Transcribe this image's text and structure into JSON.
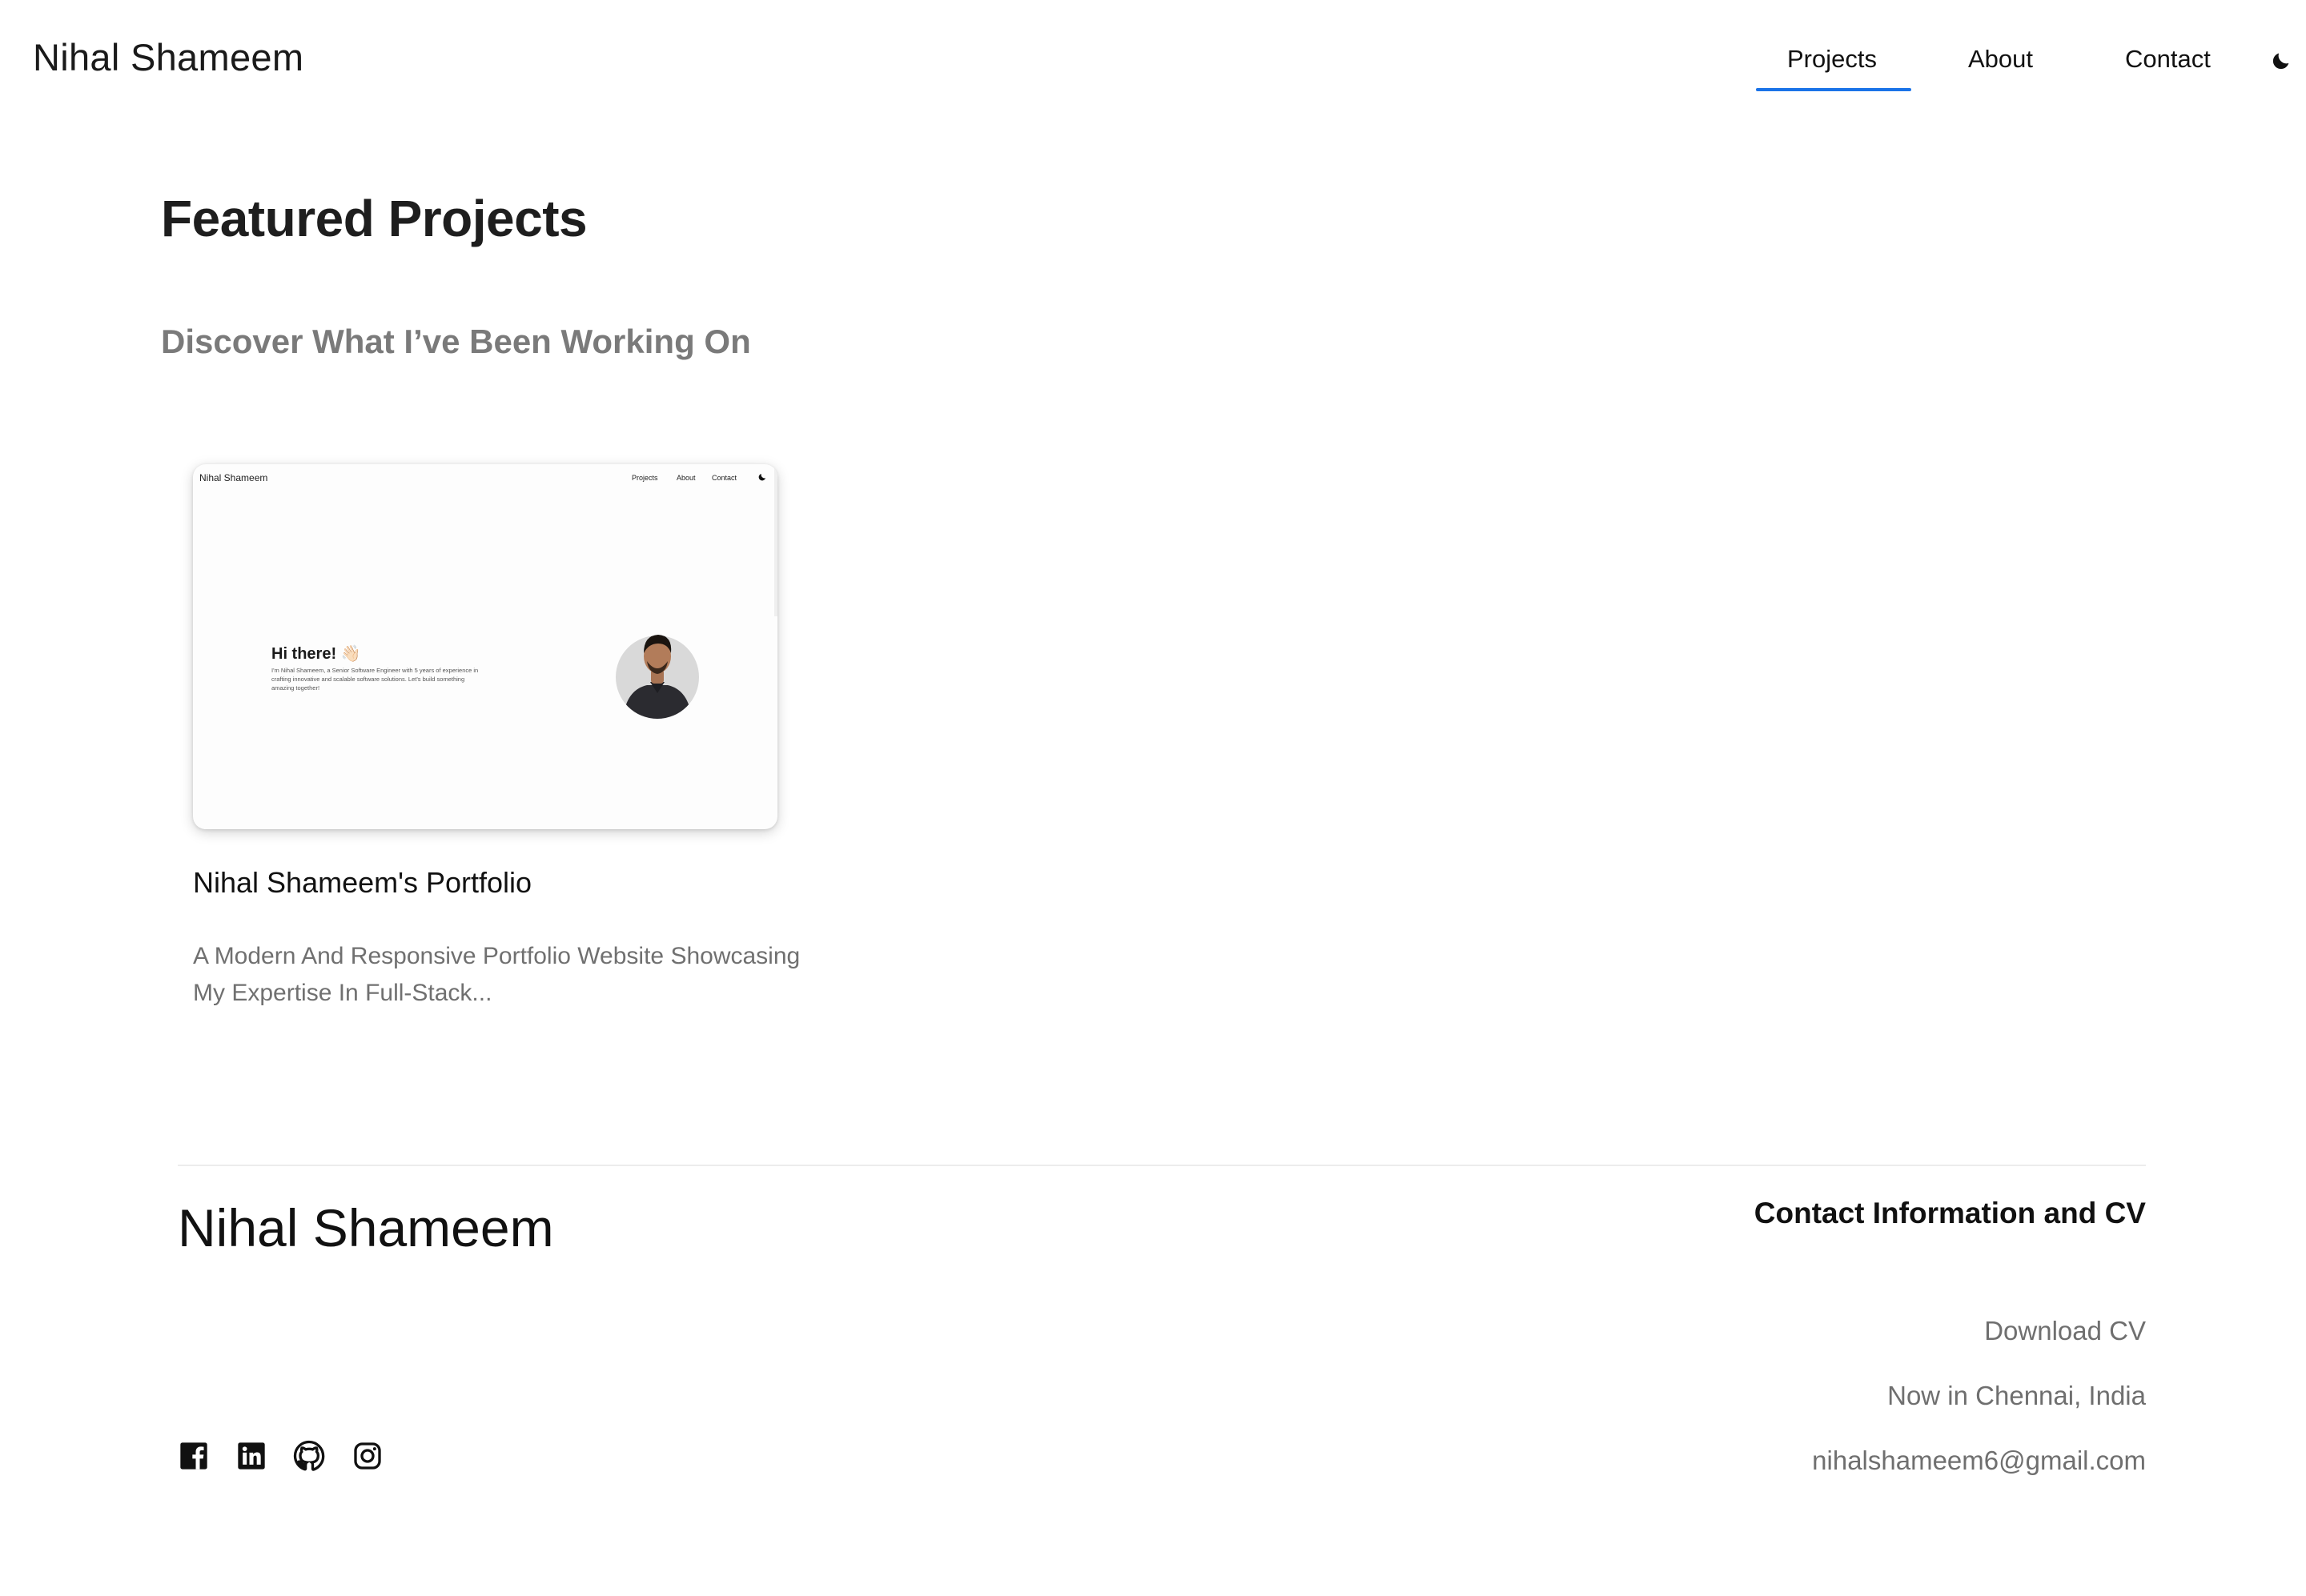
{
  "header": {
    "brand": "Nihal Shameem",
    "nav": [
      {
        "label": "Projects",
        "active": true
      },
      {
        "label": "About"
      },
      {
        "label": "Contact"
      }
    ],
    "theme_toggle_icon": "moon-icon",
    "accent_color": "#1a73e8"
  },
  "hero": {
    "title": "Featured Projects",
    "subtitle": "Discover What I’ve Been Working On"
  },
  "projects": [
    {
      "title": "Nihal Shameem's Portfolio",
      "description": "A Modern And Responsive Portfolio Website Showcasing My Expertise In Full-Stack...",
      "thumbnail": {
        "brand": "Nihal Shameem",
        "nav": [
          "Projects",
          "About",
          "Contact"
        ],
        "greeting": "Hi there! 👋🏻",
        "intro": "I'm Nihal Shameem, a Senior Software Engineer with 5 years of experience in crafting innovative and scalable software solutions. Let's build something amazing together!"
      }
    }
  ],
  "footer": {
    "brand": "Nihal Shameem",
    "contact_heading": "Contact Information and CV",
    "links": {
      "cv": "Download CV",
      "location": "Now in Chennai, India",
      "email": "nihalshameem6@gmail.com"
    },
    "socials": [
      "facebook-icon",
      "linkedin-icon",
      "github-icon",
      "instagram-icon"
    ]
  }
}
